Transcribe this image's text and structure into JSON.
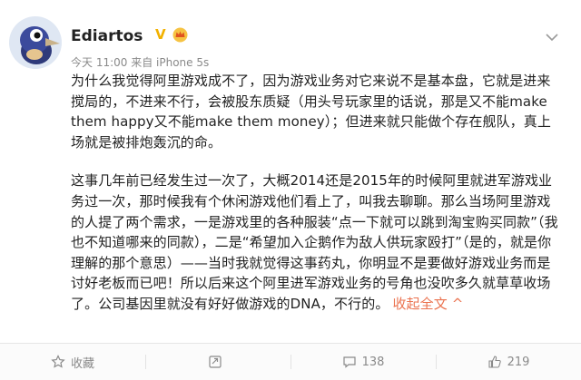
{
  "post": {
    "username": "Ediartos",
    "verified_badge": "V",
    "meta": "今天 11:00 来自 iPhone 5s",
    "paragraphs": [
      "为什么我觉得阿里游戏成不了，因为游戏业务对它来说不是基本盘，它就是进来搅局的，不进来不行，会被股东质疑（用头号玩家里的话说，那是又不能make them happy又不能make them money）；但进来就只能做个存在舰队，真上场就是被排炮轰沉的命。",
      "这事几年前已经发生过一次了，大概2014还是2015年的时候阿里就进军游戏业务过一次，那时候我有个休闲游戏他们看上了，叫我去聊聊。那么当场阿里游戏的人提了两个需求，一是游戏里的各种服装“点一下就可以跳到淘宝购买同款”（我也不知道哪来的同款），二是“希望加入企鹅作为敌人供玩家殴打”（是的，就是你理解的那个意思）——当时我就觉得这事药丸，你明显不是要做好游戏业务而是讨好老板而已吧！所以后来这个阿里进军游戏业务的号角也没吹多久就草草收场了。公司基因里就没有好好做游戏的DNA，不行的。"
    ],
    "collapse_label": "收起全文",
    "collapse_arrow": "^"
  },
  "actions": {
    "favorite_label": "收藏",
    "repost_count": "",
    "comment_count": "138",
    "like_count": "219"
  },
  "icons": [
    "avatar-bird-icon",
    "vip-crown-icon",
    "chevron-down-icon",
    "star-icon",
    "repost-icon",
    "comment-icon",
    "like-icon"
  ],
  "colors": {
    "link": "#eb7350",
    "badge": "#f2b100",
    "meta": "#8a8a8a"
  }
}
